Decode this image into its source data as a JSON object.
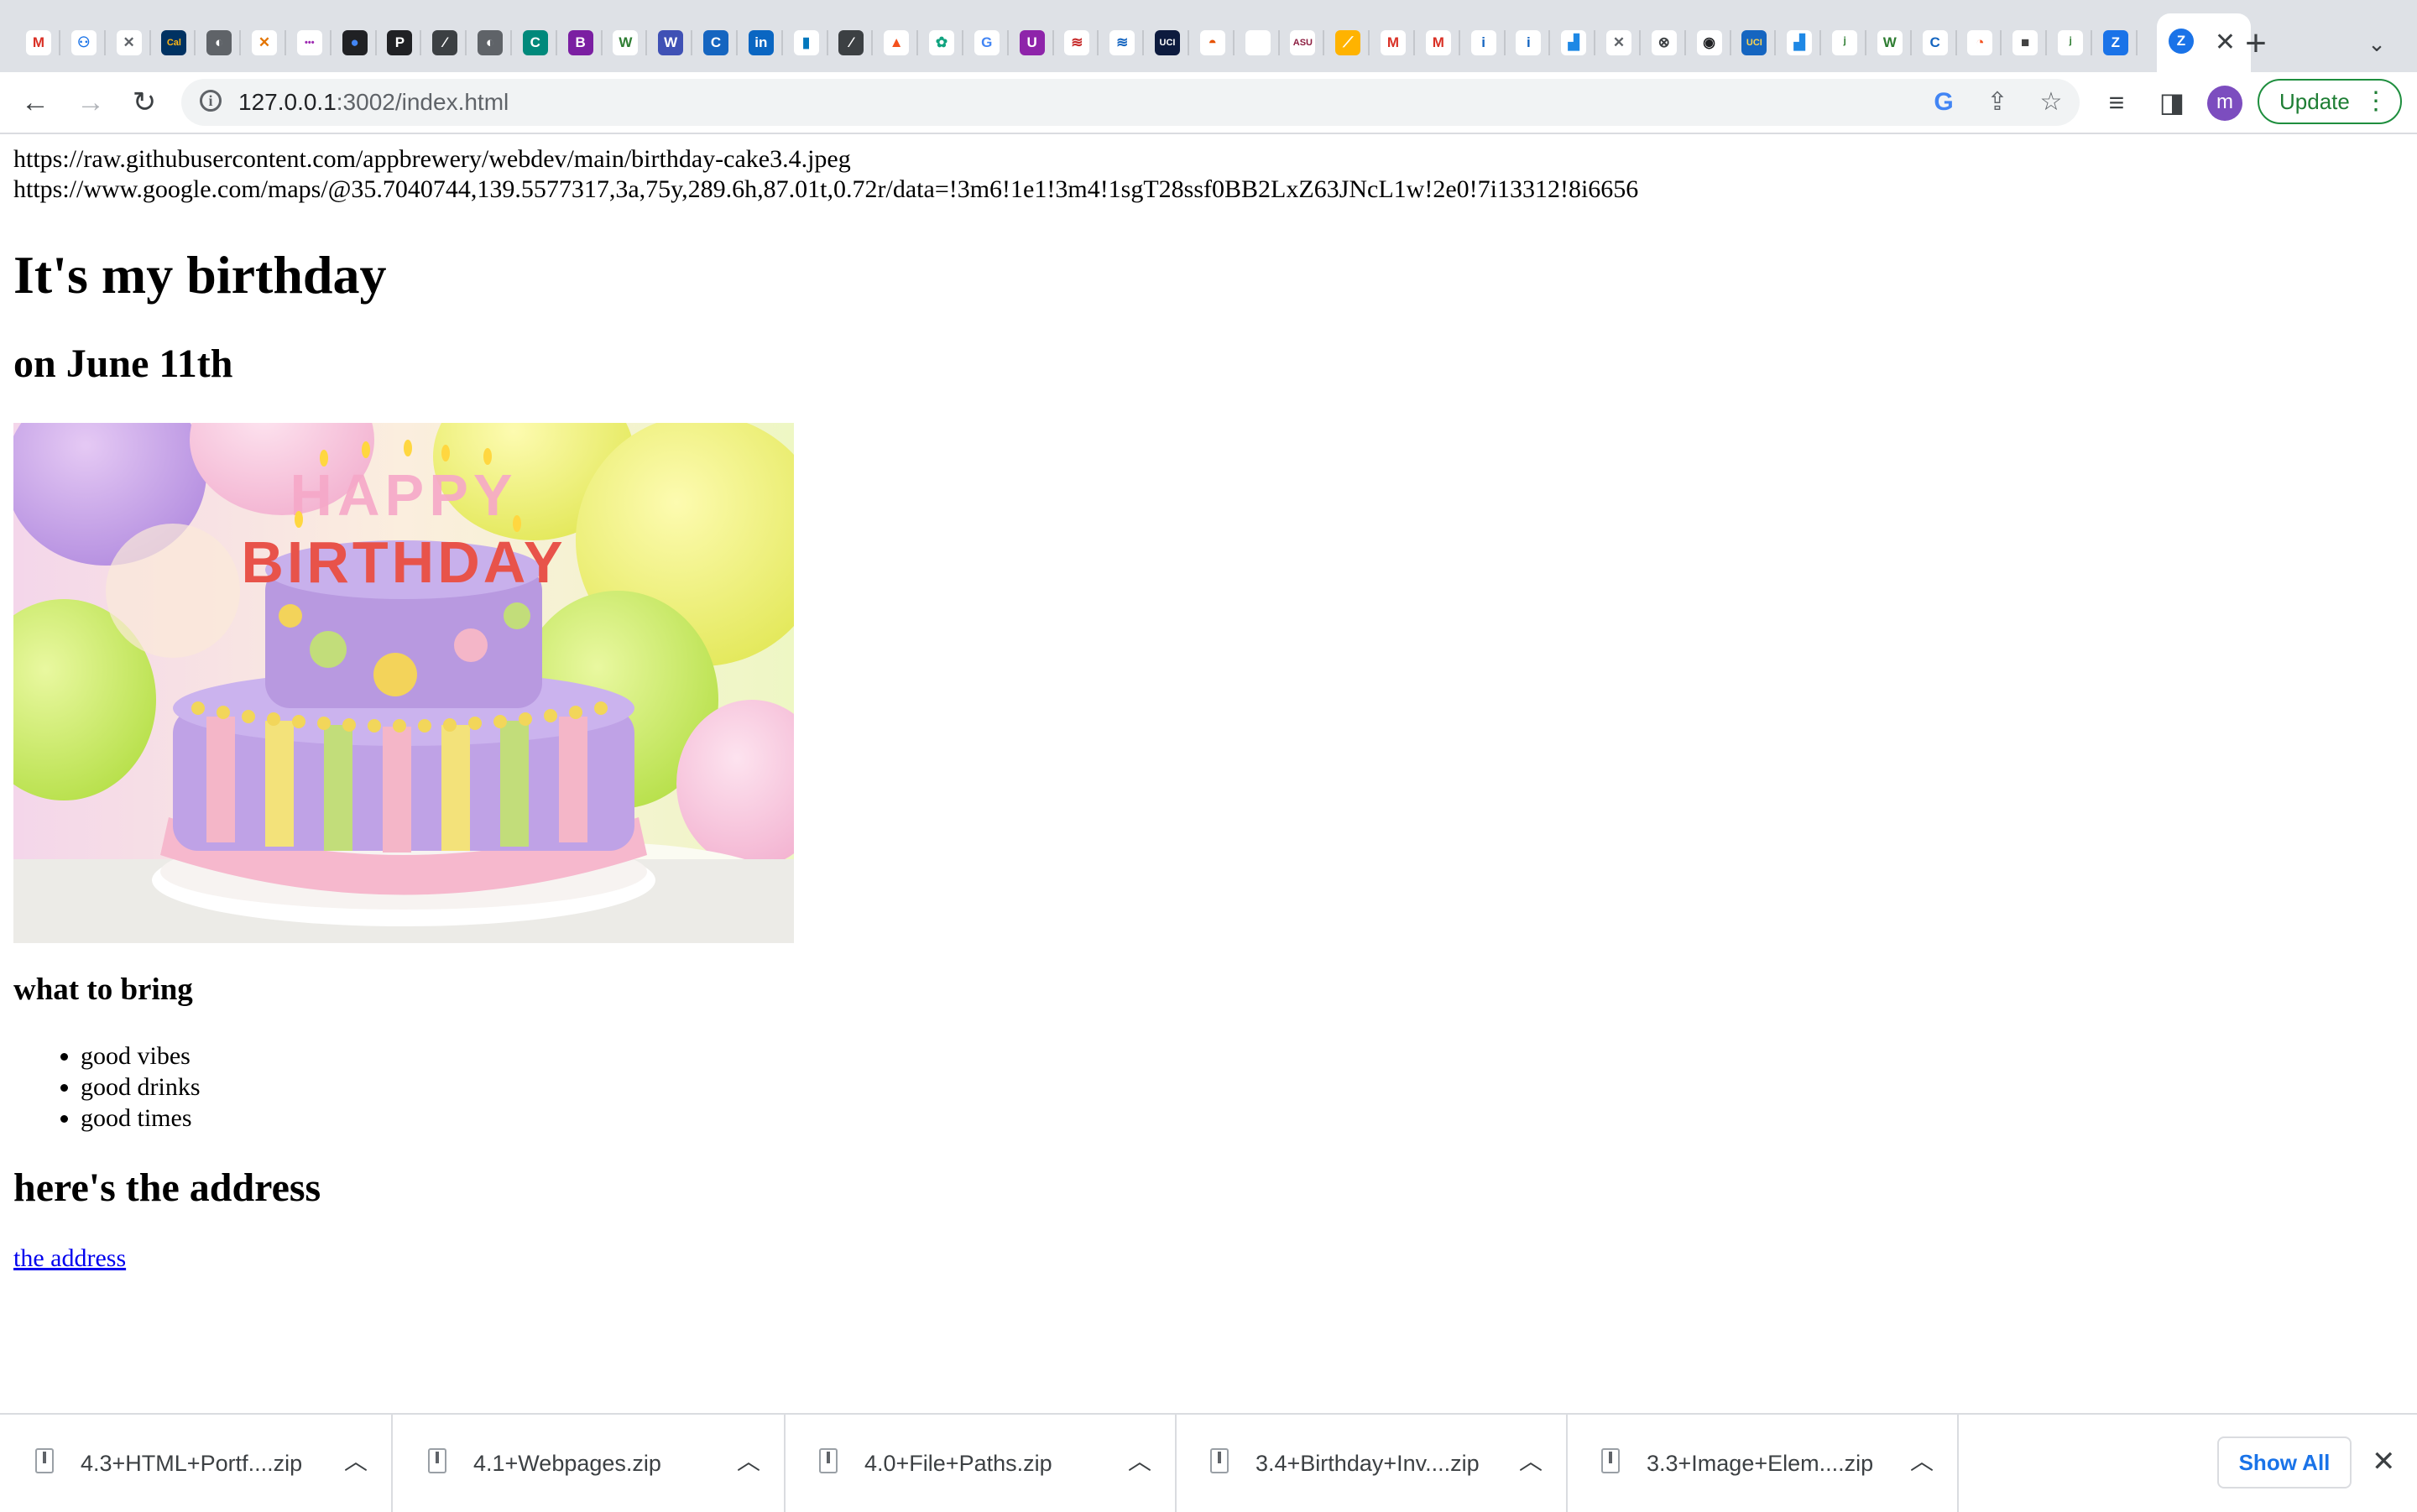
{
  "browser": {
    "url_host": "127.0.0.1",
    "url_rest": ":3002/index.html",
    "profile_initial": "m",
    "update_label": "Update",
    "tabs": [
      {
        "icon": "gmail-icon",
        "glyph": "M",
        "color": "#ffffff",
        "fg": "#d93025"
      },
      {
        "icon": "robot-icon",
        "glyph": "⚇",
        "color": "#ffffff",
        "fg": "#1a73e8"
      },
      {
        "icon": "tools-icon",
        "glyph": "✕",
        "color": "#ffffff",
        "fg": "#5f6368"
      },
      {
        "icon": "cal-icon",
        "glyph": "Cal",
        "color": "#003262",
        "fg": "#fdb515"
      },
      {
        "icon": "globe-icon",
        "glyph": "◐",
        "color": "#5f6368",
        "fg": "#ffffff"
      },
      {
        "icon": "tools-icon",
        "glyph": "✕",
        "color": "#ffffff",
        "fg": "#e37400"
      },
      {
        "icon": "dots-icon",
        "glyph": "•••",
        "color": "#ffffff",
        "fg": "#9c27b0"
      },
      {
        "icon": "circle-icon",
        "glyph": "●",
        "color": "#202124",
        "fg": "#4285f4"
      },
      {
        "icon": "p-icon",
        "glyph": "P",
        "color": "#202124",
        "fg": "#ffffff"
      },
      {
        "icon": "slash-icon",
        "glyph": "⁄",
        "color": "#3c4043",
        "fg": "#ffffff"
      },
      {
        "icon": "globe-icon",
        "glyph": "◐",
        "color": "#5f6368",
        "fg": "#ffffff"
      },
      {
        "icon": "cc-icon",
        "glyph": "C",
        "color": "#00897b",
        "fg": "#ffffff"
      },
      {
        "icon": "b-icon",
        "glyph": "B",
        "color": "#7b1fa2",
        "fg": "#ffffff"
      },
      {
        "icon": "w-icon",
        "glyph": "W",
        "color": "#ffffff",
        "fg": "#2e7d32"
      },
      {
        "icon": "w-icon",
        "glyph": "W",
        "color": "#3f51b5",
        "fg": "#ffffff"
      },
      {
        "icon": "c-icon",
        "glyph": "C",
        "color": "#1565c0",
        "fg": "#ffffff"
      },
      {
        "icon": "linkedin-icon",
        "glyph": "in",
        "color": "#0a66c2",
        "fg": "#ffffff"
      },
      {
        "icon": "bars-icon",
        "glyph": "▮",
        "color": "#ffffff",
        "fg": "#0277bd"
      },
      {
        "icon": "slash-icon",
        "glyph": "⁄",
        "color": "#3c4043",
        "fg": "#ffffff"
      },
      {
        "icon": "flame-icon",
        "glyph": "▲",
        "color": "#ffffff",
        "fg": "#f4511e"
      },
      {
        "icon": "openai-icon",
        "glyph": "✿",
        "color": "#ffffff",
        "fg": "#10a37f"
      },
      {
        "icon": "google-icon",
        "glyph": "G",
        "color": "#ffffff",
        "fg": "#4285f4"
      },
      {
        "icon": "u-icon",
        "glyph": "U",
        "color": "#8e24aa",
        "fg": "#ffffff"
      },
      {
        "icon": "flag-icon",
        "glyph": "≋",
        "color": "#ffffff",
        "fg": "#c62828"
      },
      {
        "icon": "flag-icon",
        "glyph": "≋",
        "color": "#ffffff",
        "fg": "#1565c0"
      },
      {
        "icon": "uci-icon",
        "glyph": "UCI",
        "color": "#0d1b3e",
        "fg": "#ffffff"
      },
      {
        "icon": "dome-icon",
        "glyph": "◓",
        "color": "#ffffff",
        "fg": "#e65100"
      },
      {
        "icon": "blank-icon",
        "glyph": "",
        "color": "#ffffff",
        "fg": "#ffffff"
      },
      {
        "icon": "asu-icon",
        "glyph": "ASU",
        "color": "#ffffff",
        "fg": "#8c1d40"
      },
      {
        "icon": "stripes-icon",
        "glyph": "⟋",
        "color": "#ffb300",
        "fg": "#ffffff"
      },
      {
        "icon": "gmail-icon",
        "glyph": "M",
        "color": "#ffffff",
        "fg": "#d93025"
      },
      {
        "icon": "gmail-icon",
        "glyph": "M",
        "color": "#ffffff",
        "fg": "#d93025"
      },
      {
        "icon": "info-icon",
        "glyph": "i",
        "color": "#ffffff",
        "fg": "#1565c0"
      },
      {
        "icon": "info-icon",
        "glyph": "i",
        "color": "#ffffff",
        "fg": "#1565c0"
      },
      {
        "icon": "chart-icon",
        "glyph": "▟",
        "color": "#ffffff",
        "fg": "#1e88e5"
      },
      {
        "icon": "tools-icon",
        "glyph": "✕",
        "color": "#ffffff",
        "fg": "#5f6368"
      },
      {
        "icon": "x-circle-icon",
        "glyph": "⊗",
        "color": "#ffffff",
        "fg": "#3c4043"
      },
      {
        "icon": "github-icon",
        "glyph": "◉",
        "color": "#ffffff",
        "fg": "#202124"
      },
      {
        "icon": "uci-icon",
        "glyph": "UCI",
        "color": "#1565c0",
        "fg": "#ffd54f"
      },
      {
        "icon": "chart-icon",
        "glyph": "▟",
        "color": "#ffffff",
        "fg": "#1e88e5"
      },
      {
        "icon": "sheet-icon",
        "glyph": "ʲ",
        "color": "#ffffff",
        "fg": "#2e7d32"
      },
      {
        "icon": "w-icon",
        "glyph": "W",
        "color": "#ffffff",
        "fg": "#2e7d32"
      },
      {
        "icon": "c-icon",
        "glyph": "C",
        "color": "#ffffff",
        "fg": "#1565c0"
      },
      {
        "icon": "chrome-icon",
        "glyph": "◔",
        "color": "#ffffff",
        "fg": "#f4511e"
      },
      {
        "icon": "cube-icon",
        "glyph": "■",
        "color": "#ffffff",
        "fg": "#424242"
      },
      {
        "icon": "sheet-icon",
        "glyph": "ʲ",
        "color": "#ffffff",
        "fg": "#2e7d32"
      },
      {
        "icon": "zoom-icon",
        "glyph": "Z",
        "color": "#1a73e8",
        "fg": "#ffffff"
      }
    ]
  },
  "page": {
    "url_line_1": "https://raw.githubusercontent.com/appbrewery/webdev/main/birthday-cake3.4.jpeg",
    "url_line_2": "https://www.google.com/maps/@35.7040744,139.5577317,3a,75y,289.6h,87.01t,0.72r/data=!3m6!1e1!3m4!1sgT28ssf0BB2LxZ63JNcL1w!2e0!7i13312!8i6656",
    "title": "It's my birthday",
    "subtitle": "on June 11th",
    "cake_candles": "HAPPY",
    "cake_candles_2": "BIRTHDAY",
    "bring_heading": "what to bring",
    "bring_items": [
      "good vibes",
      "good drinks",
      "good times"
    ],
    "address_heading": "here's the address",
    "address_link": "the address"
  },
  "downloads": {
    "items": [
      "4.3+HTML+Portf....zip",
      "4.1+Webpages.zip",
      "4.0+File+Paths.zip",
      "3.4+Birthday+Inv....zip",
      "3.3+Image+Elem....zip"
    ],
    "show_all": "Show All"
  }
}
